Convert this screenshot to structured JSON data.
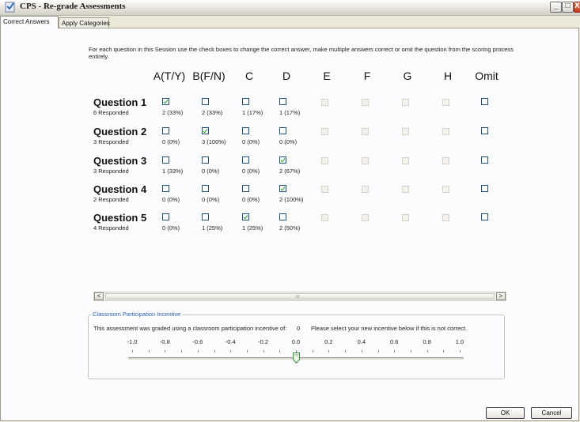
{
  "window": {
    "title": "CPS - Re-grade Assessments",
    "controls": {
      "minimize": "_",
      "maximize": "□",
      "close": "X"
    }
  },
  "tabs": [
    {
      "label": "Correct Answers",
      "active": true
    },
    {
      "label": "Apply Categories",
      "active": false
    }
  ],
  "instructions": "For each question in this Session use the check boxes to change the correct answer, make multiple answers correct or omit the question from the scoring process entirely.",
  "columns": [
    "A(T/Y)",
    "B(F/N)",
    "C",
    "D",
    "E",
    "F",
    "G",
    "H",
    "Omit"
  ],
  "questions": [
    {
      "title": "Question 1",
      "responded": "6 Responded",
      "answers": [
        {
          "pct": "2 (33%)",
          "checked": true
        },
        {
          "pct": "2 (33%)",
          "checked": false
        },
        {
          "pct": "1 (17%)",
          "checked": false
        },
        {
          "pct": "1 (17%)",
          "checked": false
        }
      ],
      "omit": false
    },
    {
      "title": "Question 2",
      "responded": "3 Responded",
      "answers": [
        {
          "pct": "0 (0%)",
          "checked": false
        },
        {
          "pct": "3 (100%)",
          "checked": true
        },
        {
          "pct": "0 (0%)",
          "checked": false
        },
        {
          "pct": "0 (0%)",
          "checked": false
        }
      ],
      "omit": false
    },
    {
      "title": "Question 3",
      "responded": "3 Responded",
      "answers": [
        {
          "pct": "1 (33%)",
          "checked": false
        },
        {
          "pct": "0 (0%)",
          "checked": false
        },
        {
          "pct": "0 (0%)",
          "checked": false
        },
        {
          "pct": "2 (67%)",
          "checked": true
        }
      ],
      "omit": false
    },
    {
      "title": "Question 4",
      "responded": "2 Responded",
      "answers": [
        {
          "pct": "0 (0%)",
          "checked": false
        },
        {
          "pct": "0 (0%)",
          "checked": false
        },
        {
          "pct": "0 (0%)",
          "checked": false
        },
        {
          "pct": "2 (100%)",
          "checked": true
        }
      ],
      "omit": false
    },
    {
      "title": "Question 5",
      "responded": "4 Responded",
      "answers": [
        {
          "pct": "0 (0%)",
          "checked": false
        },
        {
          "pct": "1 (25%)",
          "checked": false
        },
        {
          "pct": "1 (25%)",
          "checked": true
        },
        {
          "pct": "2 (50%)",
          "checked": false
        }
      ],
      "omit": false
    }
  ],
  "scrollbar": {
    "left_arrow": "<",
    "right_arrow": ">",
    "grip": "III"
  },
  "incentive": {
    "legend": "Classroom Participation Incentive",
    "graded_text": "This assessment was graded using a classroom participation incentive of:",
    "current_value": "0",
    "select_text": "Please select your new incentive below if this is not correct.",
    "ticks": [
      "-1.0",
      "-0.8",
      "-0.6",
      "-0.4",
      "-0.2",
      "0.0",
      "0.2",
      "0.4",
      "0.6",
      "0.8",
      "1.0"
    ],
    "slider_value": 0.0
  },
  "buttons": {
    "ok": "OK",
    "cancel": "Cancel"
  },
  "colors": {
    "legend_blue": "#2a5db0",
    "check_green": "#21a121",
    "checkbox_border": "#1c5180"
  }
}
